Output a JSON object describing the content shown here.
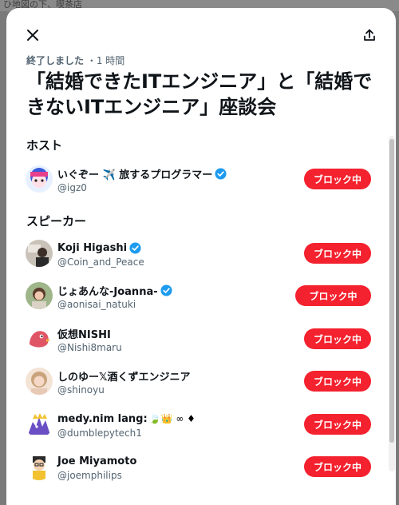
{
  "backdrop": {
    "text": "ひ地図の下、喫茶店"
  },
  "space": {
    "status_ended": "終了しました",
    "status_time": "・1 時間",
    "title": "「結婚できたITエンジニア」と「結婚できないITエンジニア」座談会"
  },
  "hosts": {
    "heading": "ホスト",
    "items": [
      {
        "name": "いぐぞー ✈️ 旅するプログラマー",
        "handle": "@igz0",
        "verified": true,
        "button": "ブロック中"
      }
    ]
  },
  "speakers": {
    "heading": "スピーカー",
    "items": [
      {
        "name": "Koji Higashi",
        "handle": "@Coin_and_Peace",
        "verified": true,
        "button": "ブロック中"
      },
      {
        "name": "じょあんな-Joanna-",
        "handle": "@aonisai_natuki",
        "verified": true,
        "button": "ブロック中"
      },
      {
        "name": "仮想NISHI",
        "handle": "@Nishi8maru",
        "verified": false,
        "button": "ブロック中"
      },
      {
        "name": "しのゆー𝕏酒くずエンジニア",
        "handle": "@shinoyu",
        "verified": false,
        "button": "ブロック中"
      },
      {
        "name": "medy.nim lang:",
        "name_emoji": "🍃👑 ∞ ♦",
        "handle": "@dumblepytech1",
        "verified": false,
        "button": "ブロック中"
      },
      {
        "name": "Joe Miyamoto",
        "handle": "@joemphilips",
        "verified": false,
        "button": "ブロック中"
      }
    ]
  },
  "colors": {
    "block_red": "#f4212e",
    "verified_blue": "#1d9bf0",
    "muted_text": "#536471"
  }
}
